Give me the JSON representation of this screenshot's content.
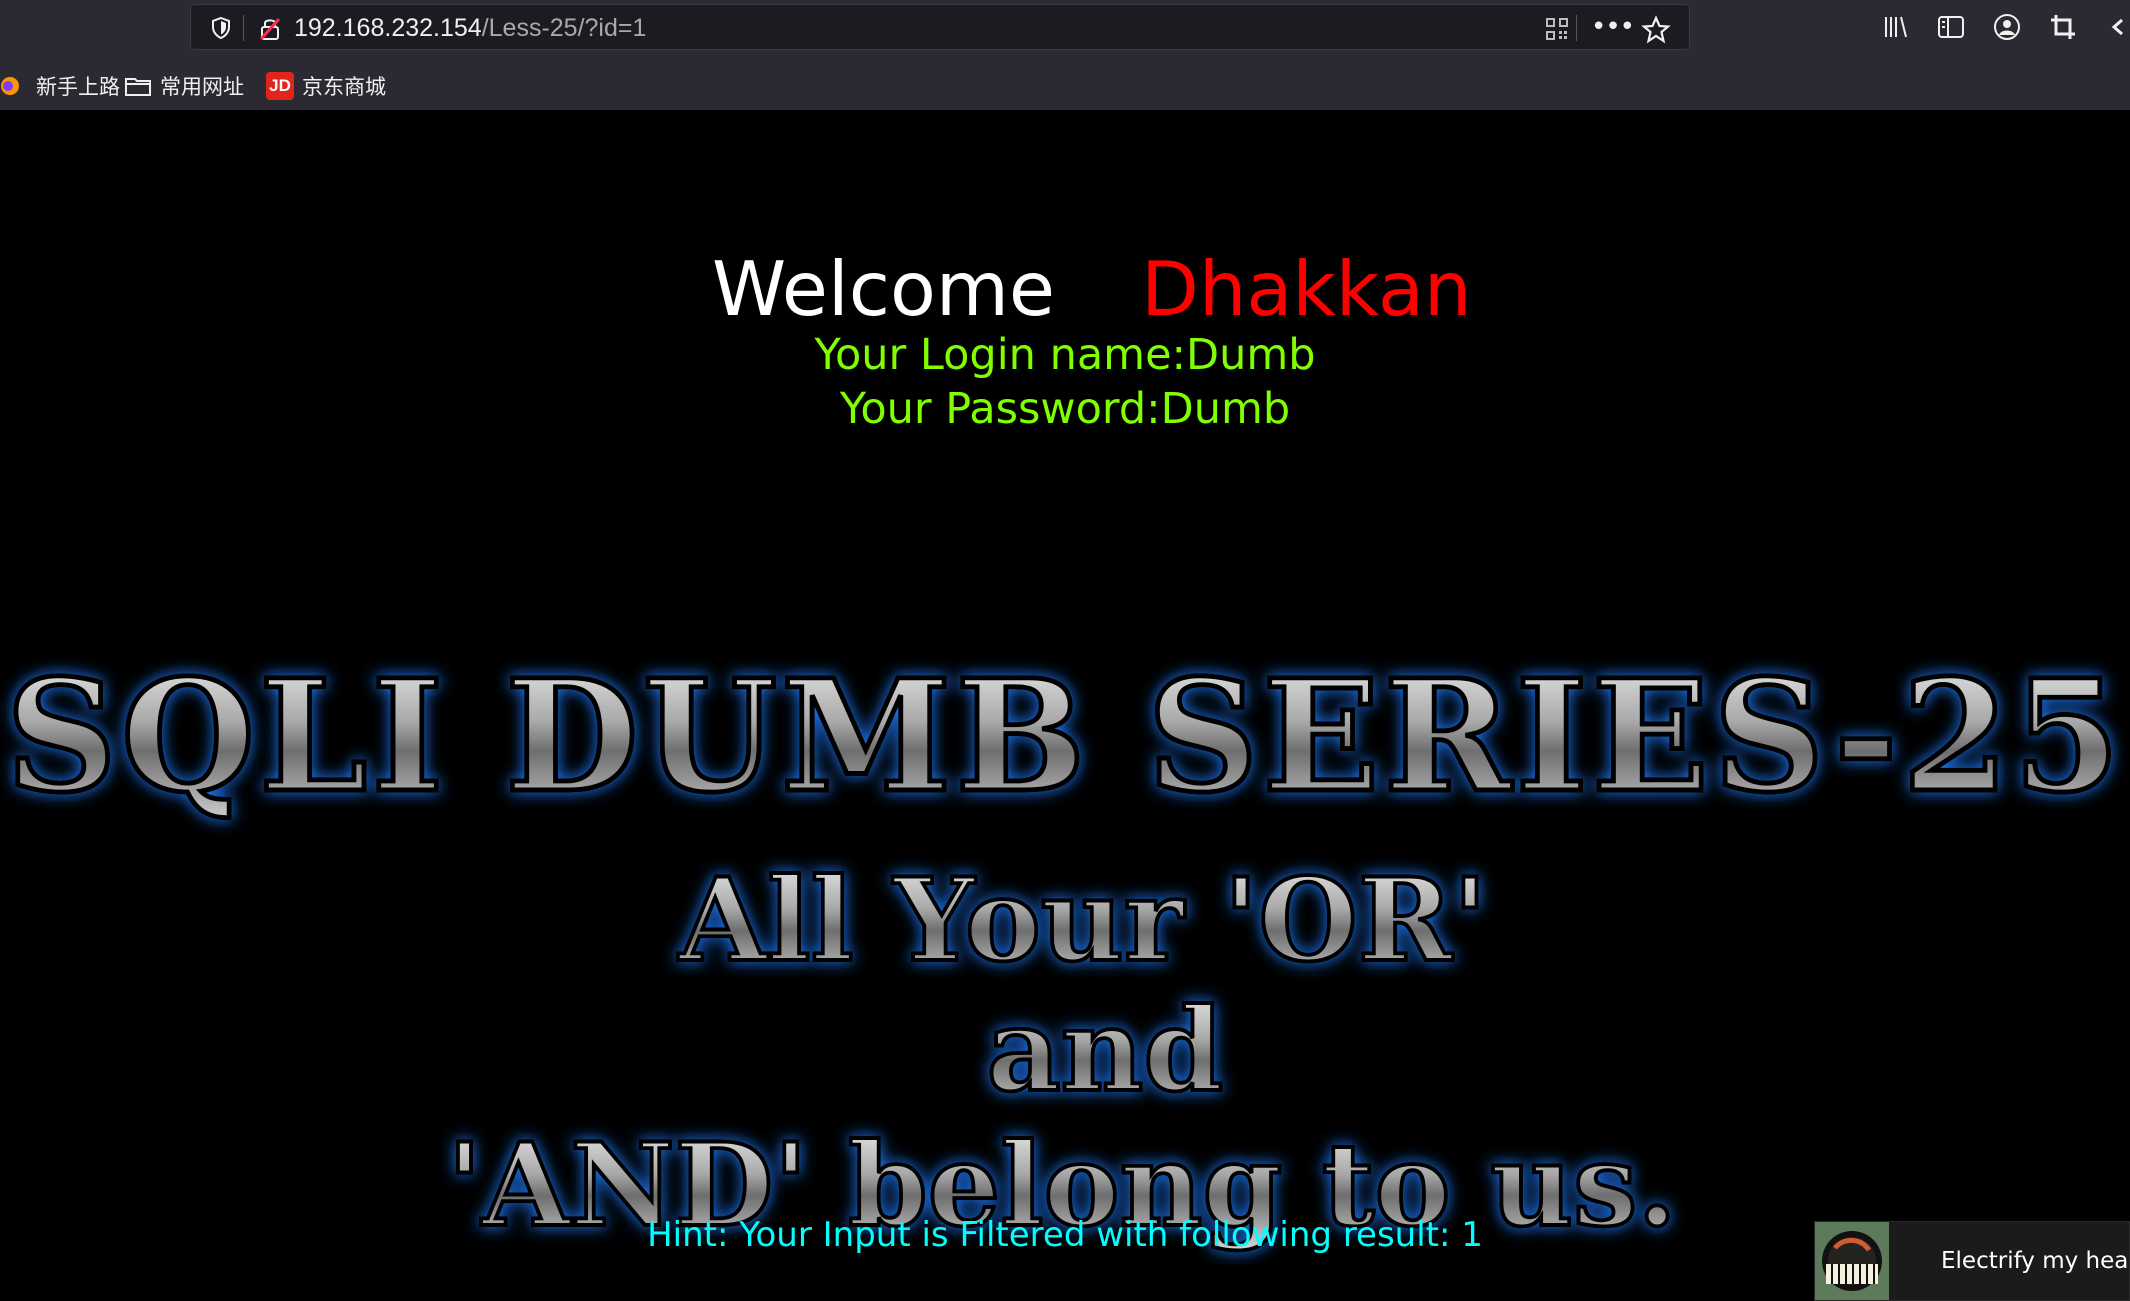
{
  "browser": {
    "address_host": "192.168.232.154",
    "address_path": "/Less-25/?id=1",
    "bookmarks": [
      {
        "label": "新手上路",
        "icon": "firefox-icon"
      },
      {
        "label": "常用网址",
        "icon": "folder-icon"
      },
      {
        "label": "京东商城",
        "icon": "jd-icon",
        "icon_text": "JD"
      }
    ]
  },
  "page": {
    "welcome_word": "Welcome",
    "user_name": "Dhakkan",
    "login_name": "Your Login name:Dumb",
    "password": "Your Password:Dumb",
    "title_image_text": "SQLI DUMB SERIES-25",
    "slogan_line_1": "All Your 'OR'",
    "slogan_line_2": "and",
    "slogan_line_3": "'AND' belong to us.",
    "hint": "Hint: Your Input is Filtered with following result: 1"
  },
  "music": {
    "song_title": "Electrify my heart"
  },
  "colors": {
    "page_background": "#000000",
    "welcome": "#ffffff",
    "user_name": "#ff0000",
    "login_info": "#7fff00",
    "hint": "#00ffff",
    "image_text_glow": "#1d7cff"
  }
}
